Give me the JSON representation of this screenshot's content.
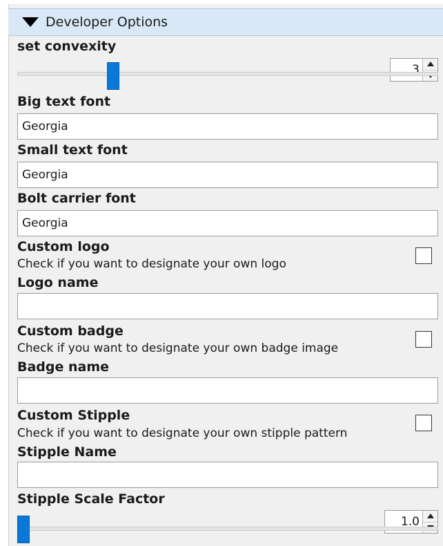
{
  "header": {
    "title": "Developer Options"
  },
  "convexity": {
    "label": "set convexity",
    "value": "3",
    "slider_fraction": 0.22
  },
  "big_text_font": {
    "label": "Big text font",
    "value": "Georgia"
  },
  "small_text_font": {
    "label": "Small text font",
    "value": "Georgia"
  },
  "bolt_carrier_font": {
    "label": "Bolt carrier font",
    "value": "Georgia"
  },
  "custom_logo": {
    "label": "Custom logo",
    "description": "Check if you want to designate your own logo",
    "checked": false
  },
  "logo_name": {
    "label": "Logo name",
    "value": ""
  },
  "custom_badge": {
    "label": "Custom badge",
    "description": "Check if you want to designate your own badge image",
    "checked": false
  },
  "badge_name": {
    "label": "Badge name",
    "value": ""
  },
  "custom_stipple": {
    "label": "Custom Stipple",
    "description": "Check if you want to designate your own stipple pattern",
    "checked": false
  },
  "stipple_name": {
    "label": "Stipple Name",
    "value": ""
  },
  "stipple_scale": {
    "label": "Stipple Scale Factor",
    "value": "1.0",
    "slider_fraction": 0.0
  },
  "colors": {
    "accent": "#0a78d7",
    "header_bg": "#d9e8f6",
    "panel_bg": "#f0f0f0"
  }
}
